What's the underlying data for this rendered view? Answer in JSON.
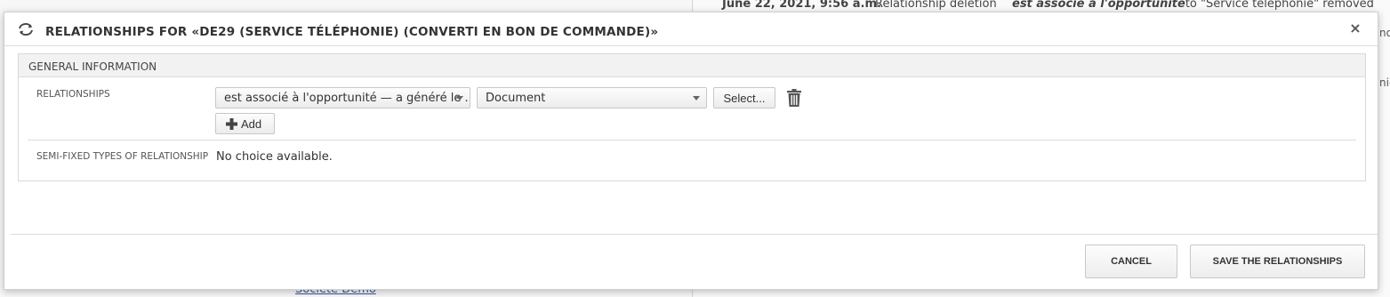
{
  "background": {
    "history_row": {
      "date": "June 22, 2021, 9:56 a.m.",
      "action": "Relationship deletion",
      "detail_emph": "est associé à l'opportunité",
      "detail_rest": " to \"Service téléphonie\" removed"
    },
    "link_text": "Société Demo",
    "right_fragment_1": "no",
    "right_fragment_2": "nie"
  },
  "modal": {
    "title": "RELATIONSHIPS FOR «DE29 (SERVICE TÉLÉPHONIE) (CONVERTI EN BON DE COMMANDE)»",
    "title_icon": "refresh-icon",
    "close_glyph": "×",
    "panel": {
      "header": "GENERAL INFORMATION",
      "relationships": {
        "label": "RELATIONSHIPS",
        "type_select_value": "est associé à l'opportunité — a généré le ...",
        "entity_select_value": "Document",
        "select_button_label": "Select...",
        "add_button_label": "Add"
      },
      "semi_fixed": {
        "label": "SEMI-FIXED TYPES OF RELATIONSHIP",
        "value": "No choice available."
      }
    },
    "footer": {
      "cancel_label": "CANCEL",
      "save_label": "SAVE THE RELATIONSHIPS"
    }
  }
}
